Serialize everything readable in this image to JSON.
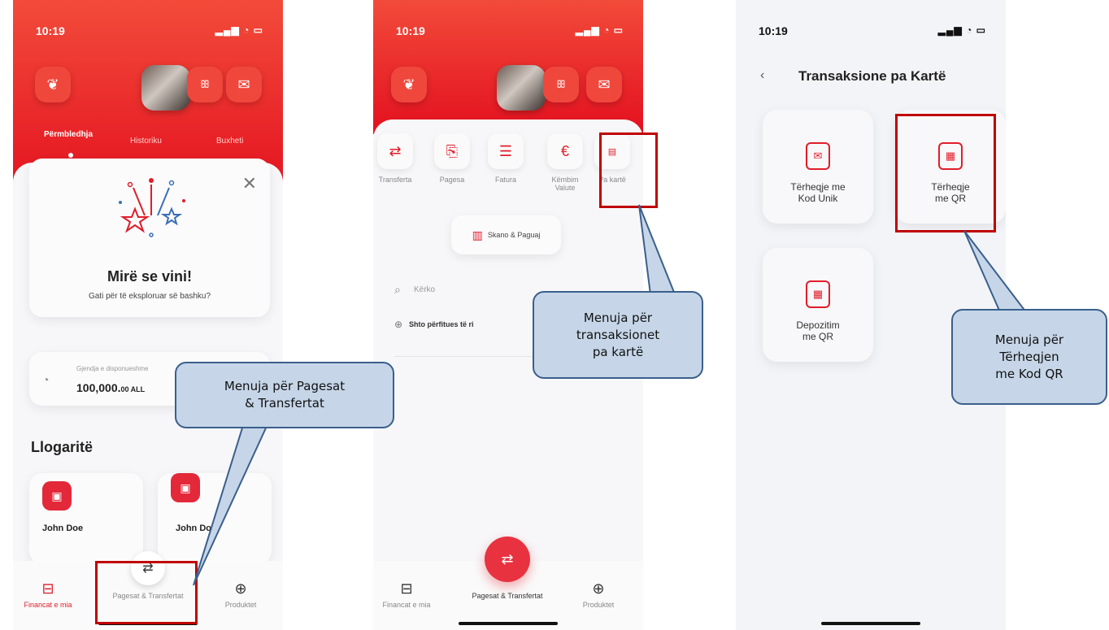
{
  "status_time": "10:19",
  "colors": {
    "brand_red": "#e3101f",
    "callout_fill": "#c6d6e8",
    "callout_border": "#3a5f8c",
    "highlight_box": "#c00000"
  },
  "icons": {
    "butterfly": "butterfly-icon",
    "people": "people-icon",
    "mail": "mail-icon",
    "transfer": "transfer-icon",
    "briefcase": "briefcase-icon",
    "plus_circle": "plus-circle-icon",
    "search": "search-icon",
    "back": "back-chevron-icon"
  },
  "screen1": {
    "tabs": [
      "Përmbledhja",
      "Historiku",
      "Buxheti"
    ],
    "welcome_title": "Mirë se vini!",
    "welcome_subtitle": "Gati për të eksploruar së bashku?",
    "balance_label": "Gjendja e disponueshme",
    "balance_value": "100,000.",
    "balance_decimals": "00 ALL",
    "accounts_heading": "Llogaritë",
    "account1_name": "John Doe",
    "account2_name": "John Doe",
    "nav": [
      "Financat e mia",
      "Pagesat & Transfertat",
      "Produktet"
    ]
  },
  "screen2": {
    "actions": [
      "Transferta",
      "Pagesa",
      "Fatura",
      "Këmbim Valute",
      "Pa kartë"
    ],
    "scan_button": "Skano & Paguaj",
    "search_placeholder": "Kërko",
    "add_beneficiary": "Shto përfitues të ri",
    "nav": [
      "Financat e mia",
      "Pagesat & Transfertat",
      "Produktet"
    ]
  },
  "screen3": {
    "title": "Transaksione pa Kartë",
    "tiles": [
      {
        "line1": "Tërheqje me",
        "line2": "Kod Unik"
      },
      {
        "line1": "Tërheqje",
        "line2": "me QR"
      },
      {
        "line1": "Depozitim",
        "line2": "me QR"
      }
    ]
  },
  "callouts": {
    "c1_line1": "Menuja për Pagesat",
    "c1_line2": "& Transfertat",
    "c2_line1": "Menuja për",
    "c2_line2": "transaksionet",
    "c2_line3": "pa kartë",
    "c3_line1": "Menuja për",
    "c3_line2": "Tërheqjen",
    "c3_line3": "me Kod QR"
  }
}
